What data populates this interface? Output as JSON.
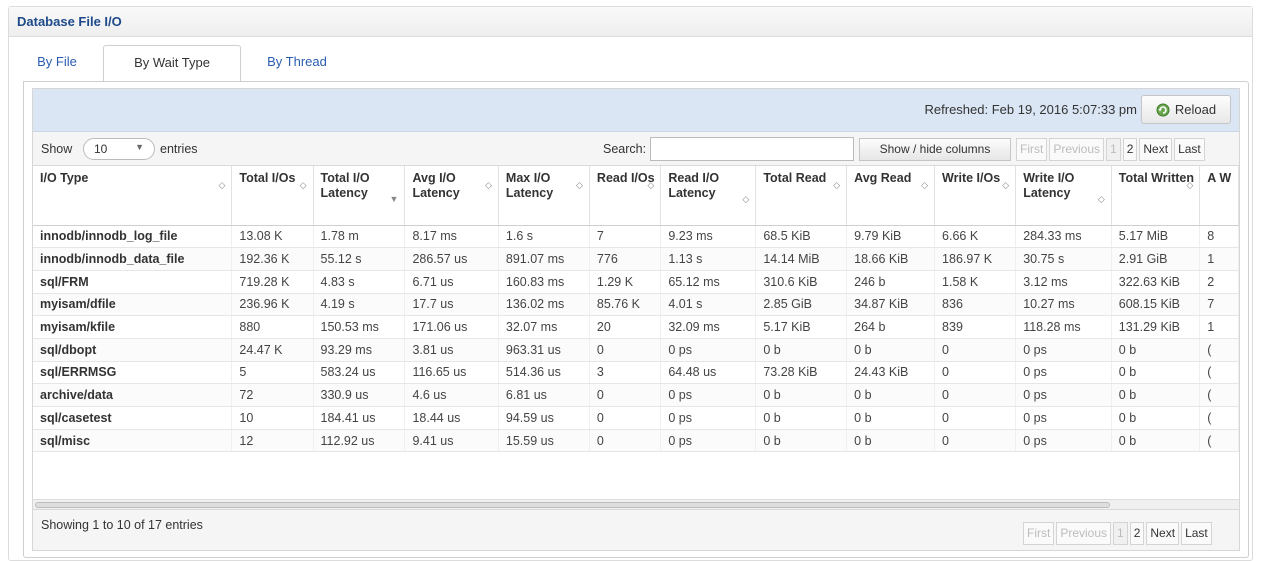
{
  "panel": {
    "title": "Database File I/O"
  },
  "tabs": [
    {
      "label": "By File"
    },
    {
      "label": "By Wait Type"
    },
    {
      "label": "By Thread"
    }
  ],
  "toolbar": {
    "refreshed": "Refreshed: Feb 19, 2016 5:07:33 pm",
    "reload_label": "Reload"
  },
  "controls": {
    "show_label": "Show",
    "page_size": "10",
    "entries_label": "entries",
    "search_label": "Search:",
    "search_value": "",
    "show_hide_label": "Show / hide columns"
  },
  "pager": {
    "first": "First",
    "previous": "Previous",
    "page1": "1",
    "page2": "2",
    "next": "Next",
    "last": "Last"
  },
  "table": {
    "columns": [
      {
        "label": "I/O Type"
      },
      {
        "label": "Total I/Os"
      },
      {
        "label": "Total I/O Latency"
      },
      {
        "label": "Avg I/O Latency"
      },
      {
        "label": "Max I/O Latency"
      },
      {
        "label": "Read I/Os"
      },
      {
        "label": "Read I/O Latency"
      },
      {
        "label": "Total Read"
      },
      {
        "label": "Avg Read"
      },
      {
        "label": "Write I/Os"
      },
      {
        "label": "Write I/O Latency"
      },
      {
        "label": "Total Written"
      },
      {
        "label": "A W"
      }
    ],
    "rows": [
      [
        "innodb/innodb_log_file",
        "13.08 K",
        "1.78 m",
        "8.17 ms",
        "1.6 s",
        "7",
        "9.23 ms",
        "68.5 KiB",
        "9.79 KiB",
        "6.66 K",
        "284.33 ms",
        "5.17 MiB",
        "8"
      ],
      [
        "innodb/innodb_data_file",
        "192.36 K",
        "55.12 s",
        "286.57 us",
        "891.07 ms",
        "776",
        "1.13 s",
        "14.14 MiB",
        "18.66 KiB",
        "186.97 K",
        "30.75 s",
        "2.91 GiB",
        "1"
      ],
      [
        "sql/FRM",
        "719.28 K",
        "4.83 s",
        "6.71 us",
        "160.83 ms",
        "1.29 K",
        "65.12 ms",
        "310.6 KiB",
        "246 b",
        "1.58 K",
        "3.12 ms",
        "322.63 KiB",
        "2"
      ],
      [
        "myisam/dfile",
        "236.96 K",
        "4.19 s",
        "17.7 us",
        "136.02 ms",
        "85.76 K",
        "4.01 s",
        "2.85 GiB",
        "34.87 KiB",
        "836",
        "10.27 ms",
        "608.15 KiB",
        "7"
      ],
      [
        "myisam/kfile",
        "880",
        "150.53 ms",
        "171.06 us",
        "32.07 ms",
        "20",
        "32.09 ms",
        "5.17 KiB",
        "264 b",
        "839",
        "118.28 ms",
        "131.29 KiB",
        "1"
      ],
      [
        "sql/dbopt",
        "24.47 K",
        "93.29 ms",
        "3.81 us",
        "963.31 us",
        "0",
        "0 ps",
        "0 b",
        "0 b",
        "0",
        "0 ps",
        "0 b",
        "("
      ],
      [
        "sql/ERRMSG",
        "5",
        "583.24 us",
        "116.65 us",
        "514.36 us",
        "3",
        "64.48 us",
        "73.28 KiB",
        "24.43 KiB",
        "0",
        "0 ps",
        "0 b",
        "("
      ],
      [
        "archive/data",
        "72",
        "330.9 us",
        "4.6 us",
        "6.81 us",
        "0",
        "0 ps",
        "0 b",
        "0 b",
        "0",
        "0 ps",
        "0 b",
        "("
      ],
      [
        "sql/casetest",
        "10",
        "184.41 us",
        "18.44 us",
        "94.59 us",
        "0",
        "0 ps",
        "0 b",
        "0 b",
        "0",
        "0 ps",
        "0 b",
        "("
      ],
      [
        "sql/misc",
        "12",
        "112.92 us",
        "9.41 us",
        "15.59 us",
        "0",
        "0 ps",
        "0 b",
        "0 b",
        "0",
        "0 ps",
        "0 b",
        "("
      ]
    ]
  },
  "footer": {
    "showing": "Showing 1 to 10 of 17 entries"
  }
}
